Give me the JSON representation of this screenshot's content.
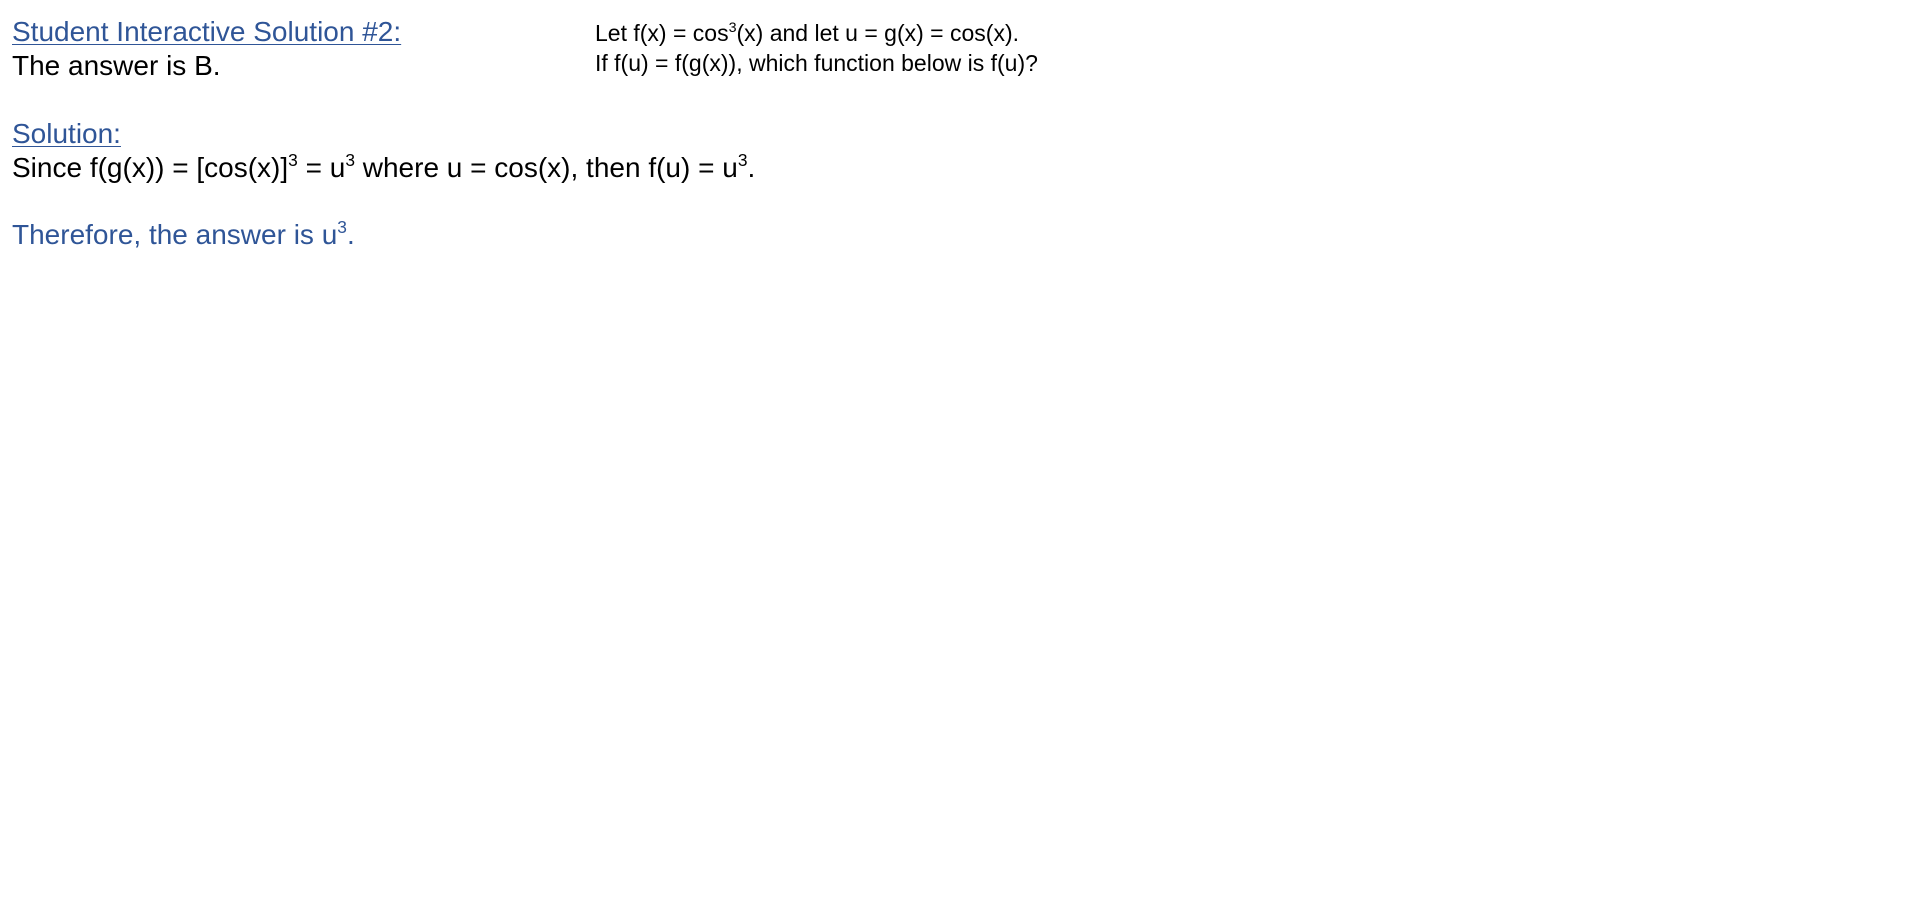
{
  "header": {
    "title_link": "Student Interactive Solution #2:",
    "answer_statement": "The answer is B."
  },
  "problem": {
    "line1": {
      "a": "Let f(x) = cos",
      "a_sup": "3",
      "b": "(x) and let u = g(x) = cos(x)."
    },
    "line2": "If f(u) = f(g(x)), which function below is f(u)?"
  },
  "solution": {
    "heading_link": "Solution:",
    "explanation": {
      "a": "Since f(g(x)) = [cos(x)]",
      "a_sup": "3",
      "b": " = u",
      "b_sup": "3",
      "c": " where u = cos(x), then f(u) = u",
      "c_sup": "3",
      "d": "."
    },
    "conclusion": {
      "a": "Therefore, the answer is u",
      "a_sup": "3",
      "b": "."
    }
  },
  "colors": {
    "link_blue": "#2f5597",
    "text": "#000000",
    "background": "#ffffff"
  }
}
